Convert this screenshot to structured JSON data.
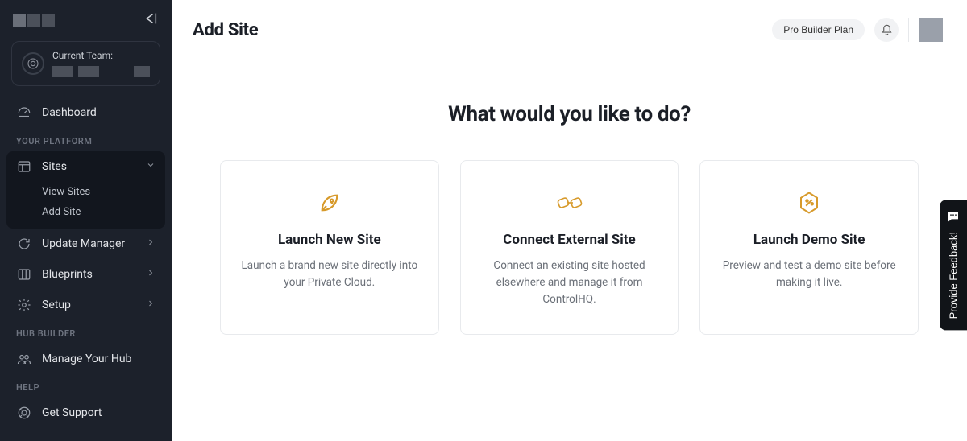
{
  "sidebar": {
    "team_label": "Current Team:",
    "dashboard": "Dashboard",
    "section_platform": "YOUR PLATFORM",
    "sites": {
      "label": "Sites",
      "sub_view": "View Sites",
      "sub_add": "Add Site"
    },
    "update_manager": "Update Manager",
    "blueprints": "Blueprints",
    "setup": "Setup",
    "section_hub": "HUB BUILDER",
    "manage_hub": "Manage Your Hub",
    "section_help": "HELP",
    "get_support": "Get Support"
  },
  "header": {
    "title": "Add Site",
    "plan": "Pro Builder Plan"
  },
  "main": {
    "heading": "What would you like to do?",
    "cards": [
      {
        "title": "Launch New Site",
        "desc": "Launch a brand new site directly into your Private Cloud."
      },
      {
        "title": "Connect External Site",
        "desc": "Connect an existing site hosted elsewhere and manage it from ControlHQ."
      },
      {
        "title": "Launch Demo Site",
        "desc": "Preview and test a demo site before making it live."
      }
    ]
  },
  "feedback": "Provide Feedback!",
  "colors": {
    "accent": "#d79a2b",
    "sidebar_bg": "#1c212b"
  }
}
